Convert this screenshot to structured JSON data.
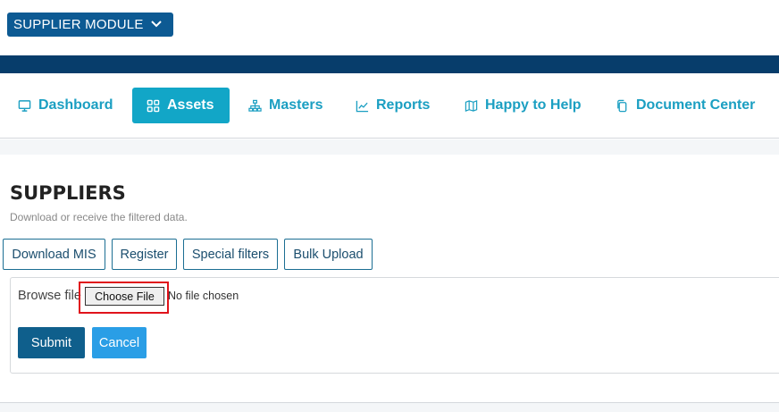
{
  "module_select": {
    "label": "SUPPLIER MODULE",
    "icon": "chevron-down-icon"
  },
  "nav": {
    "items": [
      {
        "label": "Dashboard",
        "icon": "monitor-icon"
      },
      {
        "label": "Assets",
        "icon": "grid-icon",
        "active": true
      },
      {
        "label": "Masters",
        "icon": "hierarchy-icon"
      },
      {
        "label": "Reports",
        "icon": "trend-icon"
      },
      {
        "label": "Happy to Help",
        "icon": "map-icon"
      },
      {
        "label": "Document Center",
        "icon": "copy-icon"
      }
    ]
  },
  "page": {
    "title": "SUPPLIERS",
    "subtitle": "Download or receive the filtered data."
  },
  "tabs": [
    "Download MIS",
    "Register",
    "Special filters",
    "Bulk Upload"
  ],
  "upload": {
    "label": "Browse file",
    "choose_label": "Choose File",
    "status": "No file chosen"
  },
  "actions": {
    "submit": "Submit",
    "cancel": "Cancel"
  },
  "colors": {
    "brand_dark": "#073d6b",
    "accent": "#12a6c7",
    "highlight": "#e0131b"
  }
}
